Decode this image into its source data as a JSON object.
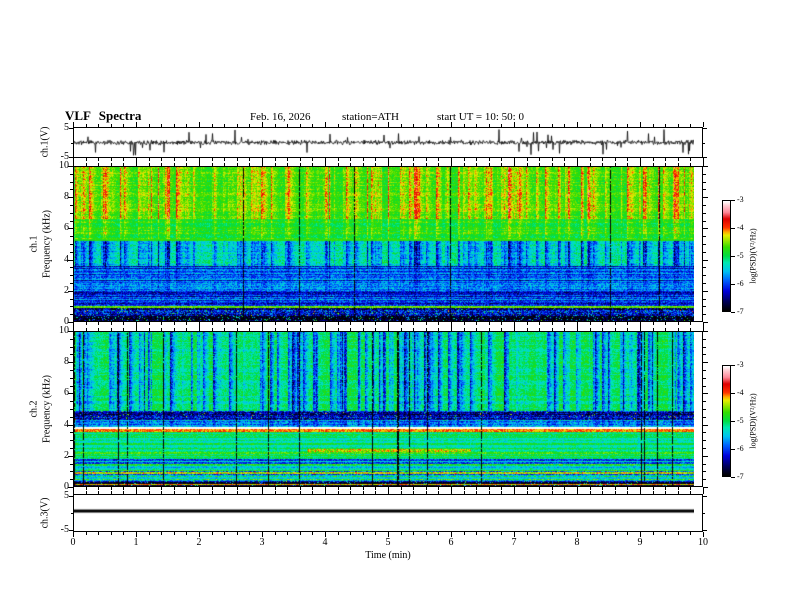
{
  "header": {
    "title": "VLF Spectra",
    "date": "Feb. 16, 2026",
    "station": "station=ATH",
    "start_ut": "start UT =  10: 50: 0"
  },
  "xaxis": {
    "label": "Time (min)",
    "tick_labels": [
      "0",
      "1",
      "2",
      "3",
      "4",
      "5",
      "6",
      "7",
      "8",
      "9",
      "10"
    ],
    "tick_values": [
      0,
      1,
      2,
      3,
      4,
      5,
      6,
      7,
      8,
      9,
      10
    ],
    "minor_step": 0.2,
    "lim": [
      0,
      10
    ],
    "data_end_min": 9.84
  },
  "panels": [
    {
      "id": "ch1-waveform",
      "ylabel": "ch.1(V)",
      "ytick_labels": [
        "5",
        "-5"
      ],
      "ytick_values": [
        5,
        -5
      ],
      "ylim": [
        -5,
        5
      ]
    },
    {
      "id": "ch1-spectrogram",
      "ylabel_ch": "ch.1",
      "ylabel_freq": "Frequency (kHz)",
      "ytick_labels": [
        "10",
        "8",
        "6",
        "4",
        "2",
        "0"
      ],
      "ytick_values": [
        10,
        8,
        6,
        4,
        2,
        0
      ],
      "minor_step": 0.5,
      "ylim": [
        0,
        10
      ]
    },
    {
      "id": "ch2-spectrogram",
      "ylabel_ch": "ch.2",
      "ylabel_freq": "Frequency (kHz)",
      "ytick_labels": [
        "10",
        "8",
        "6",
        "4",
        "2",
        "0"
      ],
      "ytick_values": [
        10,
        8,
        6,
        4,
        2,
        0
      ],
      "minor_step": 0.5,
      "ylim": [
        0,
        10
      ]
    },
    {
      "id": "ch3-waveform",
      "ylabel": "ch.3(V)",
      "ytick_labels": [
        "5",
        "-5"
      ],
      "ytick_values": [
        5,
        -5
      ],
      "ylim": [
        -5,
        5
      ]
    }
  ],
  "colorbar": {
    "label": "log(PSD)(V²/Hz)",
    "tick_labels": [
      "-3",
      "-4",
      "-5",
      "-6",
      "-7"
    ],
    "tick_values": [
      -3,
      -4,
      -5,
      -6,
      -7
    ],
    "lim": [
      -7,
      -3
    ],
    "stops": [
      [
        0,
        "#000000"
      ],
      [
        0.08,
        "#000055"
      ],
      [
        0.18,
        "#0000dd"
      ],
      [
        0.28,
        "#0066ff"
      ],
      [
        0.36,
        "#00c4f0"
      ],
      [
        0.44,
        "#00e8b0"
      ],
      [
        0.5,
        "#00dd44"
      ],
      [
        0.58,
        "#33dd00"
      ],
      [
        0.64,
        "#99e600"
      ],
      [
        0.69,
        "#e8ee00"
      ],
      [
        0.72,
        "#ffaa00"
      ],
      [
        0.76,
        "#ff3300"
      ],
      [
        0.84,
        "#dd0000"
      ],
      [
        0.9,
        "#ff8899"
      ],
      [
        0.96,
        "#ffc8d0"
      ],
      [
        1,
        "#ffffff"
      ]
    ]
  },
  "colors": {
    "background": "#ffffff",
    "frame": "#000000",
    "trace": "#000000",
    "text": "#000000"
  },
  "chart_data": [
    {
      "type": "line",
      "panel": "ch.1 waveform",
      "ylabel": "ch.1(V)",
      "xlabel": "Time (min)",
      "ylim": [
        -5,
        5
      ],
      "x_range_min": [
        0,
        9.84
      ],
      "color": "#000000",
      "signal": {
        "baseline_V": 0,
        "noise_amplitude_V": 0.7,
        "spike_probability": 0.045,
        "spike_amplitude_V": [
          1.2,
          5
        ],
        "polarity": "bipolar"
      },
      "seed": 11
    },
    {
      "type": "heatmap",
      "panel": "ch.1 spectrogram",
      "ylabel": "Frequency (kHz)",
      "xlabel": "Time (min)",
      "ylim": [
        0,
        10
      ],
      "x_range_min": [
        0,
        9.84
      ],
      "value_label": "log(PSD)(V²/Hz)",
      "value_range": [
        -7,
        -3
      ],
      "legend_position": "right-colorbar",
      "seed": 21,
      "black_column_probability": 0.012,
      "bands": [
        {
          "f": [
            6.6,
            10
          ],
          "level": -4.8,
          "noise": 0.22,
          "row_amp": 0.15,
          "streak": 1.1
        },
        {
          "f": [
            5.2,
            6.6
          ],
          "level": -4.95,
          "noise": 0.22,
          "row_amp": 0.15,
          "streak": 0.65
        },
        {
          "f": [
            3.6,
            5.2
          ],
          "level": -5.15,
          "noise": 0.3,
          "row_amp": 0.2,
          "streak": -1.5
        },
        {
          "f": [
            2.0,
            3.6
          ],
          "level": -5.85,
          "noise": 0.35,
          "row_amp": 0.45,
          "streak": -0.35
        },
        {
          "f": [
            1.0,
            2.0
          ],
          "level": -6.0,
          "noise": 0.4,
          "row_amp": 0.45,
          "streak": -0.2
        },
        {
          "f": [
            0.3,
            1.0
          ],
          "level": -6.55,
          "noise": 0.55,
          "row_amp": 0.3,
          "streak": 0.3,
          "speck": 0.1,
          "speck_amp": 1.8
        },
        {
          "f": [
            0,
            0.3
          ],
          "level": -6.85,
          "noise": 0.3,
          "row_amp": 0.2,
          "streak": 0,
          "speck": 0.15,
          "speck_amp": 2.2
        }
      ],
      "hlines": [
        {
          "f": 5.25,
          "level": -4.75,
          "width_khz": 0.12,
          "noise": 0.15
        },
        {
          "f": 0.9,
          "level": -4.55,
          "width_khz": 0.15,
          "noise": 0.2
        }
      ],
      "segments": []
    },
    {
      "type": "heatmap",
      "panel": "ch.2 spectrogram",
      "ylabel": "Frequency (kHz)",
      "xlabel": "Time (min)",
      "ylim": [
        0,
        10
      ],
      "x_range_min": [
        0,
        9.84
      ],
      "value_label": "log(PSD)(V²/Hz)",
      "value_range": [
        -7,
        -3
      ],
      "legend_position": "right-colorbar",
      "seed": 33,
      "black_column_probability": 0.02,
      "bands": [
        {
          "f": [
            4.9,
            10
          ],
          "level": -5.0,
          "noise": 0.25,
          "row_amp": 0.18,
          "streak": -1.6
        },
        {
          "f": [
            4.3,
            4.9
          ],
          "level": -6.35,
          "noise": 0.5,
          "row_amp": 0.35,
          "streak": -0.2,
          "speck": 0.05,
          "speck_amp": 2.2
        },
        {
          "f": [
            3.8,
            4.3
          ],
          "level": -5.6,
          "noise": 0.4,
          "row_amp": 0.3,
          "streak": -0.5
        },
        {
          "f": [
            2.45,
            3.5
          ],
          "level": -5.1,
          "noise": 0.25,
          "row_amp": 0.25,
          "streak": -0.15
        },
        {
          "f": [
            1.85,
            2.45
          ],
          "level": -5.05,
          "noise": 0.25,
          "row_amp": 0.3,
          "streak": -0.1
        },
        {
          "f": [
            0.95,
            1.85
          ],
          "level": -5.2,
          "noise": 0.3,
          "row_amp": 0.5,
          "streak": -0.1
        },
        {
          "f": [
            0.3,
            0.95
          ],
          "level": -5.6,
          "noise": 0.5,
          "row_amp": 0.8,
          "streak": 0
        },
        {
          "f": [
            0,
            0.3
          ],
          "level": -6.7,
          "noise": 0.4,
          "row_amp": 0.4,
          "streak": 0,
          "speck": 0.12,
          "speck_amp": 2.0
        }
      ],
      "hlines": [
        {
          "f": 3.62,
          "level": -4.05,
          "width_khz": 0.18,
          "noise": 0.25
        },
        {
          "f": 2.15,
          "level": -4.7,
          "width_khz": 0.1,
          "noise": 0.3
        },
        {
          "f": 1.7,
          "level": -6.1,
          "width_khz": 0.1,
          "noise": 0.4
        },
        {
          "f": 1.5,
          "level": -6.0,
          "width_khz": 0.08,
          "noise": 0.4
        },
        {
          "f": 0.82,
          "level": -4.35,
          "width_khz": 0.12,
          "noise": 0.4
        },
        {
          "f": 0.52,
          "level": -5.5,
          "width_khz": 0.1,
          "noise": 0.3
        },
        {
          "f": 0.1,
          "level": -4.2,
          "width_khz": 0.08,
          "noise": 0.3
        }
      ],
      "segments": [
        {
          "f": [
            2.2,
            2.42
          ],
          "t": [
            3.7,
            6.3
          ],
          "level": -4.35,
          "noise": 0.45
        }
      ]
    },
    {
      "type": "line",
      "panel": "ch.3 waveform",
      "ylabel": "ch.3(V)",
      "xlabel": "Time (min)",
      "ylim": [
        -5,
        5
      ],
      "x_range_min": [
        0,
        9.84
      ],
      "color": "#000000",
      "signal": {
        "constant_V": 0.6,
        "line_thickness_px": 3
      }
    }
  ]
}
